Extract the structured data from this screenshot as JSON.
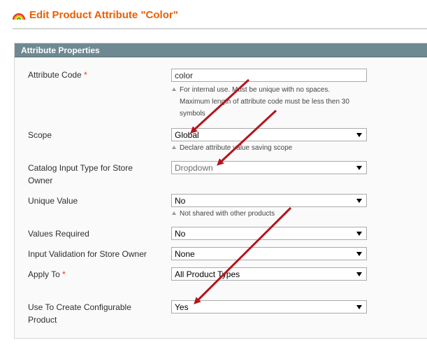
{
  "header": {
    "title": "Edit Product Attribute \"Color\"",
    "icon": "rainbow-icon"
  },
  "fieldset": {
    "legend": "Attribute Properties",
    "legend_color": "#6f8992"
  },
  "fields": {
    "attribute_code": {
      "label": "Attribute Code",
      "required_mark": "*",
      "value": "color",
      "note_1": "For internal use. Must be unique with no spaces.",
      "note_2": "Maximum length of attribute code must be less then 30",
      "note_3": "symbols"
    },
    "scope": {
      "label": "Scope",
      "value": "Global",
      "note": "Declare attribute value saving scope"
    },
    "catalog_input_type": {
      "label_1": "Catalog Input Type for Store",
      "label_2": "Owner",
      "value": "Dropdown"
    },
    "unique_value": {
      "label": "Unique Value",
      "value": "No",
      "note": "Not shared with other products"
    },
    "values_required": {
      "label": "Values Required",
      "value": "No"
    },
    "input_validation": {
      "label": "Input Validation for Store Owner",
      "value": "None"
    },
    "apply_to": {
      "label": "Apply To",
      "required_mark": "*",
      "value": "All Product Types"
    },
    "configurable": {
      "label_1": "Use To Create Configurable",
      "label_2": "Product",
      "value": "Yes"
    }
  },
  "colors": {
    "title": "#eb5e00",
    "required": "#eb340a",
    "annotation_arrow": "#b3161c"
  }
}
